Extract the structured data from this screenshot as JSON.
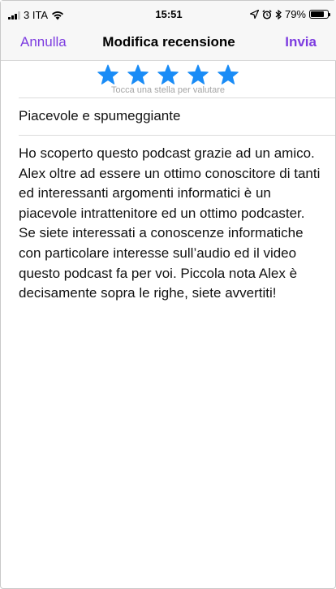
{
  "status_bar": {
    "carrier": "3 ITA",
    "time": "15:51",
    "battery": "79%",
    "battery_level": 0.79
  },
  "nav": {
    "cancel_label": "Annulla",
    "title": "Modifica recensione",
    "send_label": "Invia",
    "accent_color": "#7d3ce0"
  },
  "rating": {
    "stars_selected": 5,
    "stars_total": 5,
    "star_color": "#1a8cf6",
    "hint": "Tocca una stella per valutare"
  },
  "review": {
    "title": "Piacevole e spumeggiante",
    "body": "Ho scoperto questo podcast grazie ad un amico. Alex oltre ad essere un ottimo conoscitore di tanti ed interessanti argomenti informatici è un piacevole intrattenitore ed un ottimo podcaster. Se siete interessati a conoscenze informatiche con particolare interesse sull’audio ed il video questo podcast fa per voi. Piccola nota Alex è decisamente sopra le righe, siete avvertiti!"
  }
}
